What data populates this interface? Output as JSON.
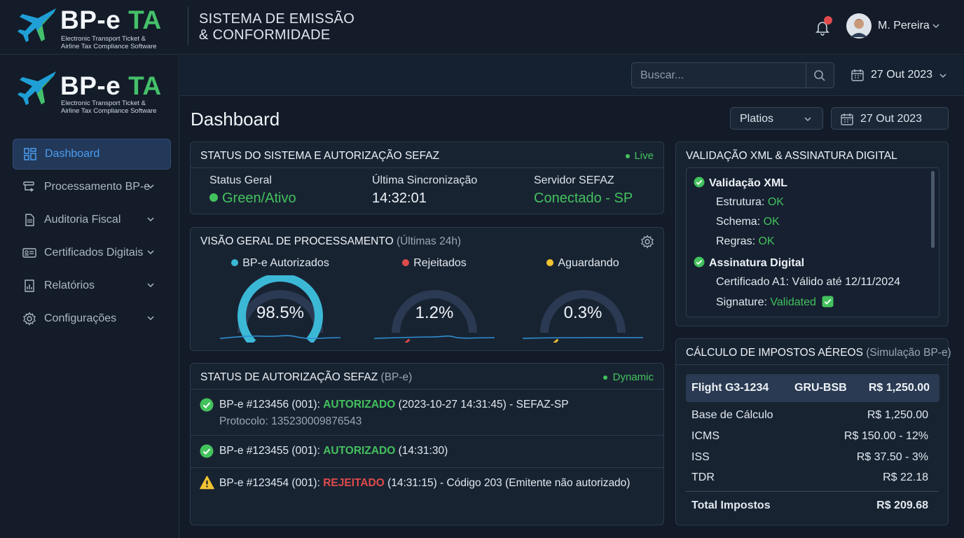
{
  "brand": {
    "name_a": "BP-e ",
    "name_b": "TA",
    "subtitle_1": "Electronic Transport Ticket &",
    "subtitle_2": "Airline Tax Compliance Software"
  },
  "header": {
    "title_1": "SISTEMA DE EMISSÃO",
    "title_2": "& CONFORMIDADE",
    "user": "M. Pereira"
  },
  "toolbar": {
    "search_placeholder": "Buscar...",
    "date": "27 Out 2023"
  },
  "sidebar": {
    "items": [
      {
        "label": "Dashboard"
      },
      {
        "label": "Processamento BP-e"
      },
      {
        "label": "Auditoria Fiscal"
      },
      {
        "label": "Certificados Digitais"
      },
      {
        "label": "Relatórios"
      },
      {
        "label": "Configurações"
      }
    ]
  },
  "page": {
    "title": "Dashboard",
    "filter": "Platios",
    "date": "27 Out 2023"
  },
  "system_status": {
    "title": "STATUS DO SISTEMA E AUTORIZAÇÃO SEFAZ",
    "badge": "Live",
    "items": [
      {
        "label": "Status Geral",
        "value": "Green/Ativo"
      },
      {
        "label": "Última Sincronização",
        "value": "14:32:01"
      },
      {
        "label": "Servidor SEFAZ",
        "value": "Conectado - SP"
      }
    ]
  },
  "processing": {
    "title": "VISÃO GERAL DE PROCESSAMENTO",
    "period": "(Últimas 24h)",
    "gauges": [
      {
        "label": "BP-e Autorizados",
        "value_text": "98.5%",
        "value": 98.5,
        "color": "#3bb8d6"
      },
      {
        "label": "Rejeitados",
        "value_text": "1.2%",
        "value": 1.2,
        "color": "#e04b4b"
      },
      {
        "label": "Aguardando",
        "value_text": "0.3%",
        "value": 0.3,
        "color": "#f0c330"
      }
    ]
  },
  "authorization": {
    "title": "STATUS DE AUTORIZAÇÃO SEFAZ",
    "suffix": "(BP-e)",
    "badge": "Dynamic",
    "rows": [
      {
        "prefix": "BP-e #123456 (001): ",
        "status": "AUTORIZADO",
        "rest": " (2023-10-27 14:31:45) - SEFAZ-SP",
        "detail": "Protocolo: 135230009876543"
      },
      {
        "prefix": "BP-e #123455 (001): ",
        "status": "AUTORIZADO",
        "rest": " (14:31:30)"
      },
      {
        "prefix": "BP-e #123454 (001): ",
        "status": "REJEITADO",
        "rest": " (14:31:15) - Código 203 (Emitente não autorizado)"
      }
    ]
  },
  "xml": {
    "title": "VALIDAÇÃO XML & ASSINATURA DIGITAL",
    "validation_title": "Validação XML",
    "checks": [
      {
        "label": "Estrutura: ",
        "value": "OK"
      },
      {
        "label": "Schema: ",
        "value": "OK"
      },
      {
        "label": "Regras: ",
        "value": "OK"
      }
    ],
    "signature_title": "Assinatura Digital",
    "certificate": "Certificado A1: Válido até 12/11/2024",
    "signature_label": "Signature: ",
    "signature_value": "Validated"
  },
  "taxes": {
    "title": "CÁLCULO DE IMPOSTOS AÉREOS",
    "suffix": "(Simulação BP-e)",
    "flight": "Flight G3-1234",
    "route": "GRU-BSB",
    "flight_amount": "R$ 1,250.00",
    "rows": [
      {
        "label": "Base de Cálculo",
        "value": "R$ 1,250.00"
      },
      {
        "label": "ICMS",
        "value": "R$ 150.00 - 12%"
      },
      {
        "label": "ISS",
        "value": "R$ 37.50 - 3%"
      },
      {
        "label": "TDR",
        "value": "R$ 22.18"
      }
    ],
    "total_label": "Total Impostos",
    "total_value": "R$ 209.68"
  }
}
